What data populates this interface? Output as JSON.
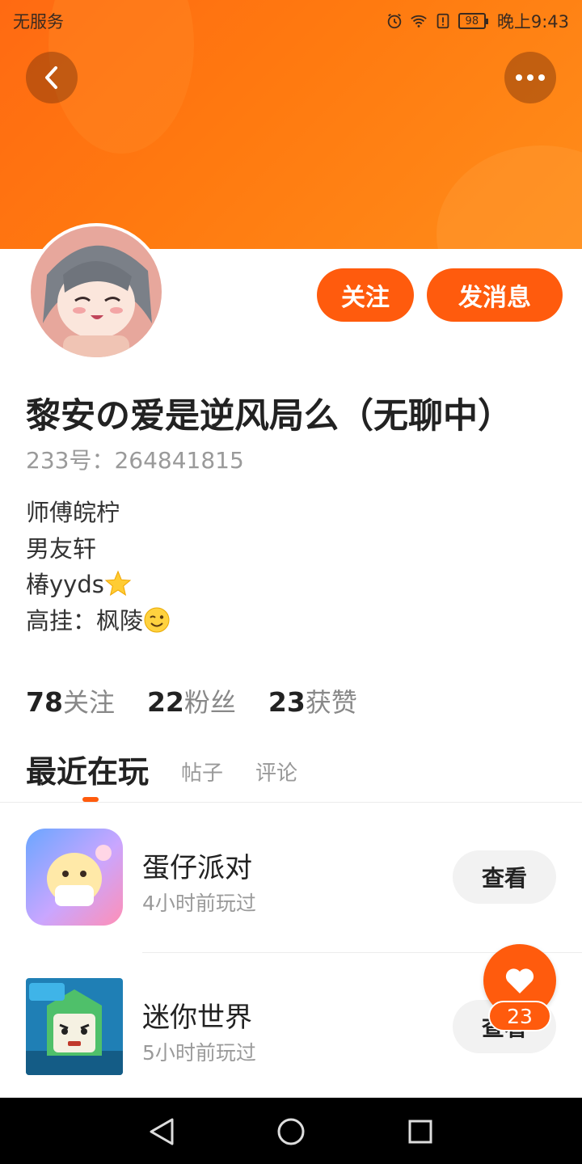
{
  "status_bar": {
    "carrier": "无服务",
    "battery": "98",
    "time": "晚上9:43"
  },
  "header": {
    "back_icon": "chevron-left-icon",
    "more_icon": "more-horizontal-icon",
    "accent_color": "#ff5b0d"
  },
  "profile": {
    "follow_label": "关注",
    "message_label": "发消息",
    "nickname": "黎安の爱是逆风局么（无聊中）",
    "uid": "233号：264841815",
    "bio": [
      "师傅皖柠",
      "男友轩",
      "椿yyds",
      "高挂：枫陵"
    ],
    "bio_emojis": [
      "star-emoji",
      "wink-emoji"
    ]
  },
  "stats": [
    {
      "value": "78",
      "label": "关注"
    },
    {
      "value": "22",
      "label": "粉丝"
    },
    {
      "value": "23",
      "label": "获赞"
    }
  ],
  "tabs": {
    "active": "最近在玩",
    "items": [
      "帖子",
      "评论"
    ]
  },
  "games": [
    {
      "name": "蛋仔派对",
      "time": "4小时前玩过",
      "action": "查看"
    },
    {
      "name": "迷你世界",
      "time": "5小时前玩过",
      "action": "查看"
    }
  ],
  "like_fab": {
    "count": "23",
    "icon": "heart-icon"
  },
  "nav": {
    "icons": [
      "back-triangle-icon",
      "home-circle-icon",
      "recents-square-icon"
    ]
  }
}
